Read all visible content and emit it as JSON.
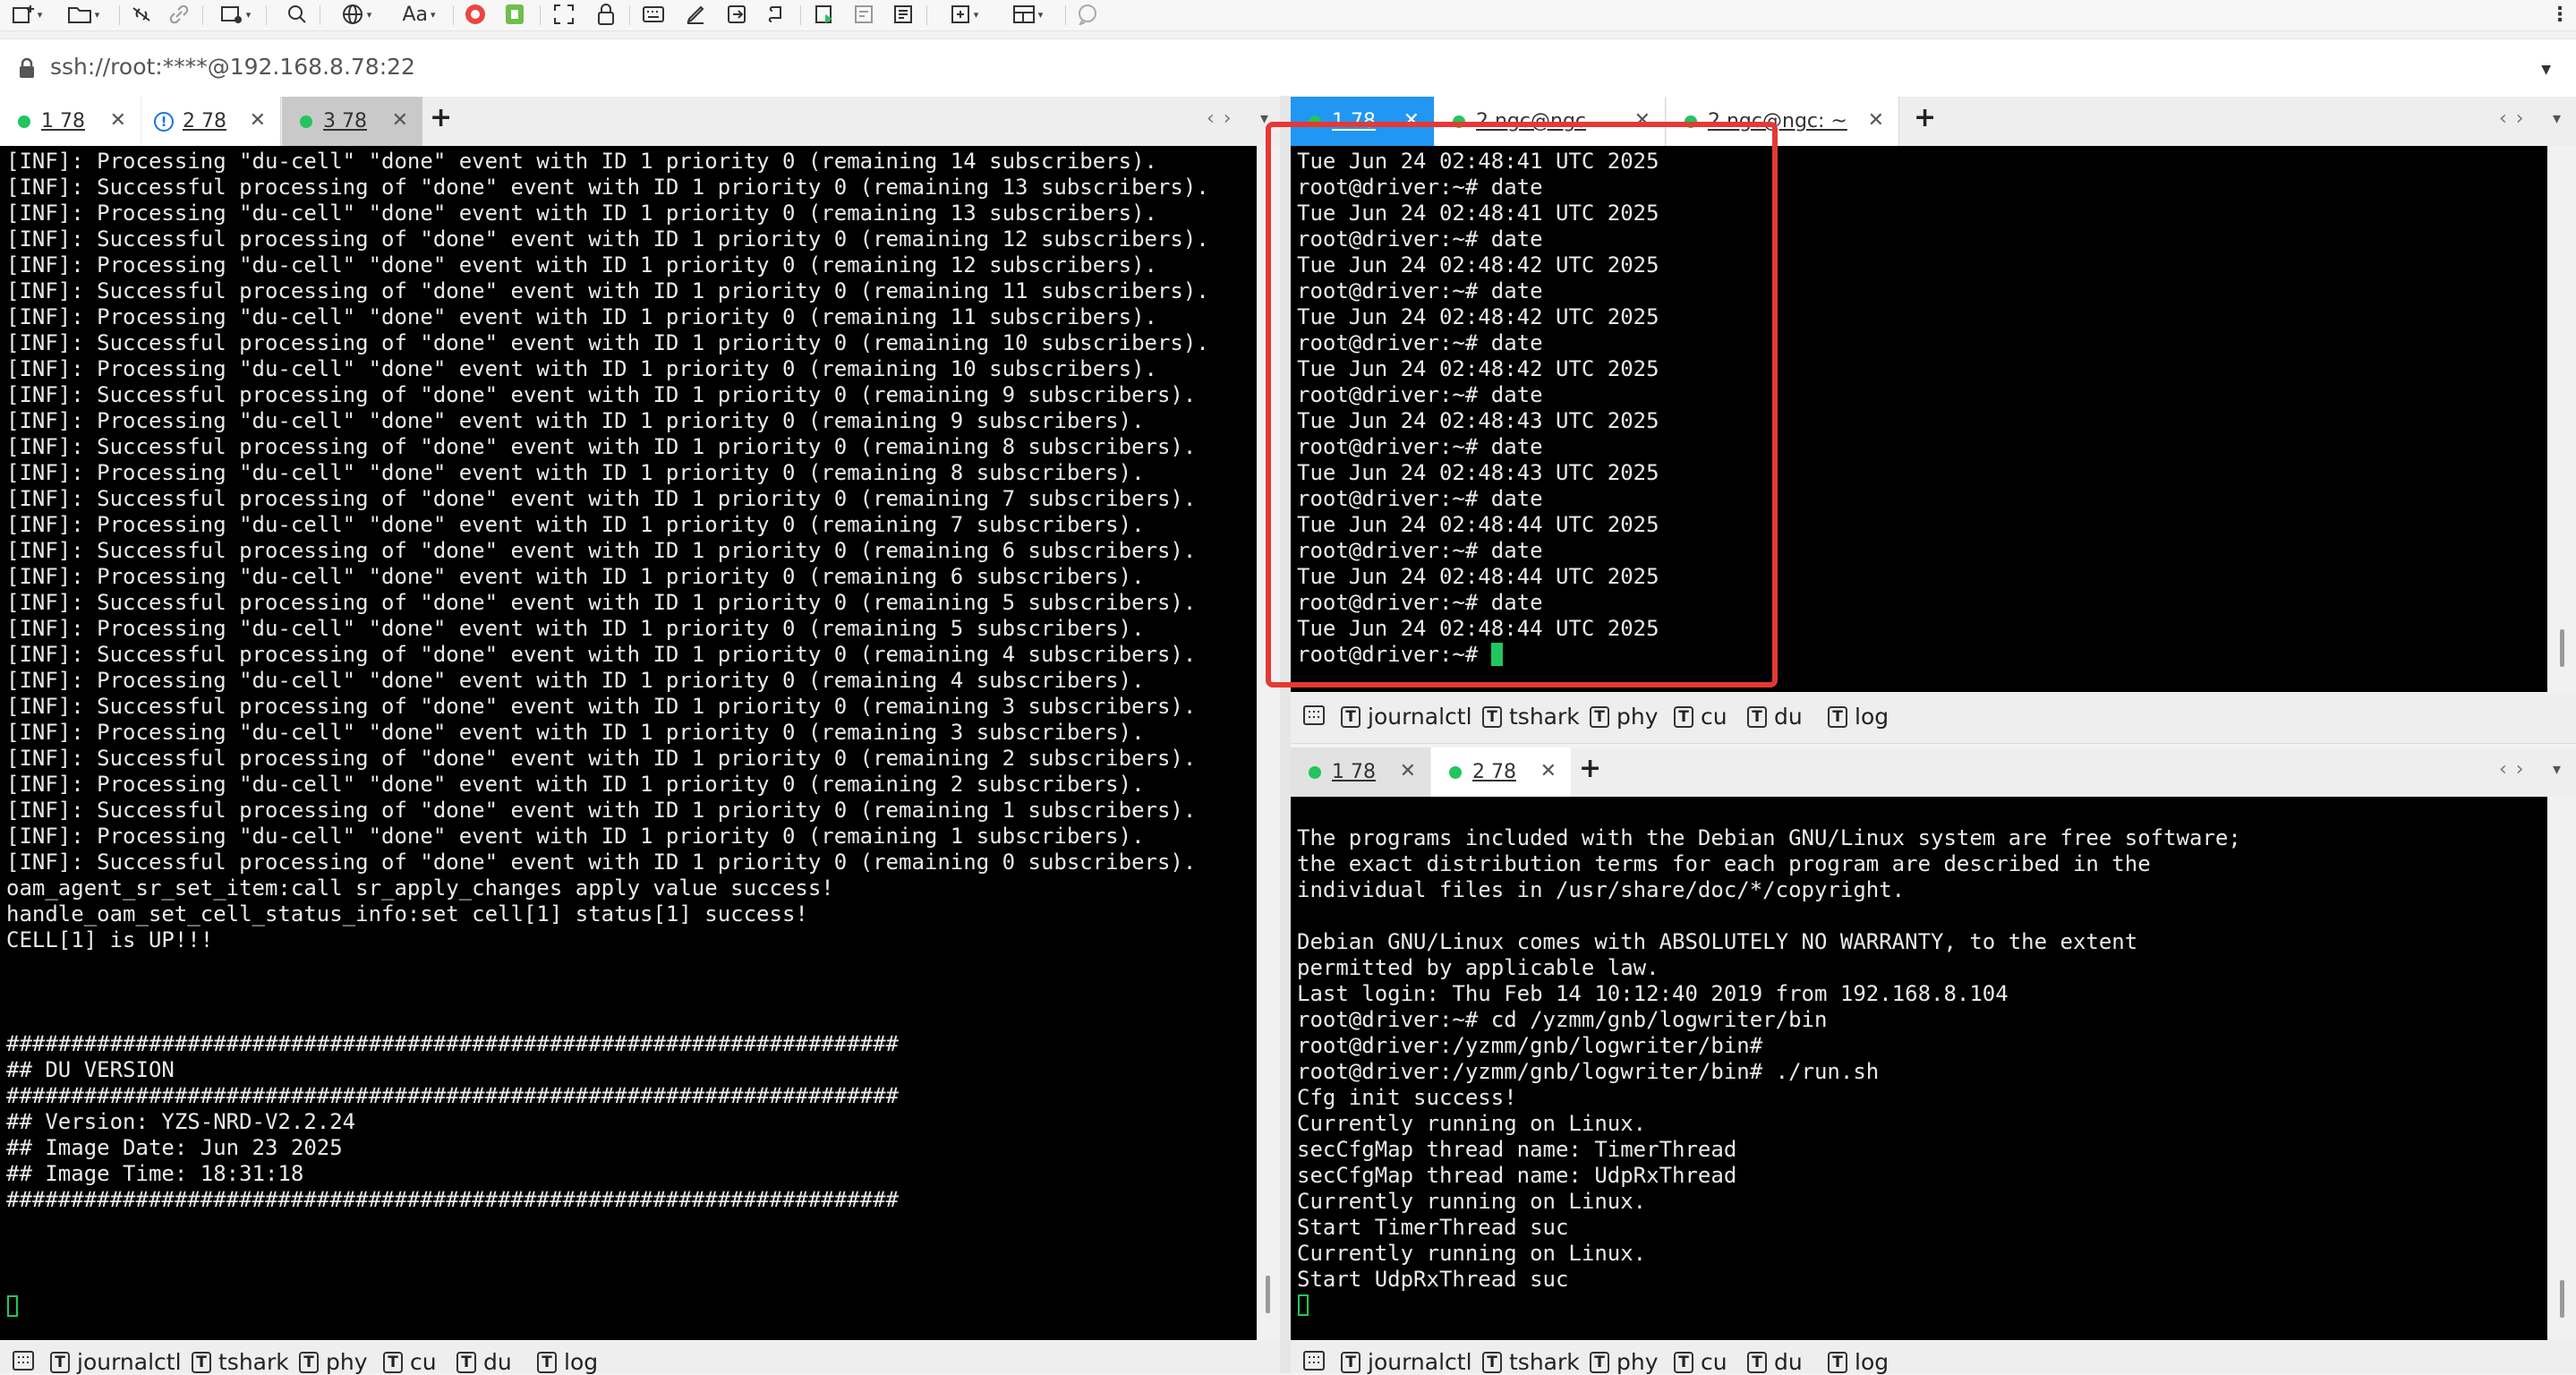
{
  "toolbar": {
    "icons": [
      "new-session-icon",
      "open-folder-icon",
      "unlink-icon",
      "link-icon",
      "new-window-icon",
      "search-icon",
      "globe-icon",
      "font-icon",
      "record-icon",
      "file-transfer-icon",
      "fullscreen-icon",
      "lock-icon",
      "keyboard-icon",
      "sign-icon",
      "import-icon",
      "script-icon",
      "play-script-icon",
      "compose-icon",
      "notes-icon",
      "add-pane-icon",
      "layout-icon",
      "chat-icon",
      "more-icon"
    ],
    "font_label": "Aa"
  },
  "address": {
    "url": "ssh://root:****@192.168.8.78:22"
  },
  "left_tabs": [
    {
      "label": "1 78",
      "status": "connected"
    },
    {
      "label": "2 78",
      "status": "warning"
    },
    {
      "label": "3 78",
      "status": "connected"
    }
  ],
  "right_top_tabs": [
    {
      "label": "1 78",
      "status": "connected"
    },
    {
      "label": "2 ngc@ngc",
      "status": "connected"
    },
    {
      "label": "2 ngc@ngc: ~",
      "status": "connected"
    }
  ],
  "right_bottom_tabs": [
    {
      "label": "1 78",
      "status": "connected"
    },
    {
      "label": "2 78",
      "status": "connected"
    }
  ],
  "terminals": {
    "left": "[INF]: Processing \"du-cell\" \"done\" event with ID 1 priority 0 (remaining 14 subscribers).\n[INF]: Successful processing of \"done\" event with ID 1 priority 0 (remaining 13 subscribers).\n[INF]: Processing \"du-cell\" \"done\" event with ID 1 priority 0 (remaining 13 subscribers).\n[INF]: Successful processing of \"done\" event with ID 1 priority 0 (remaining 12 subscribers).\n[INF]: Processing \"du-cell\" \"done\" event with ID 1 priority 0 (remaining 12 subscribers).\n[INF]: Successful processing of \"done\" event with ID 1 priority 0 (remaining 11 subscribers).\n[INF]: Processing \"du-cell\" \"done\" event with ID 1 priority 0 (remaining 11 subscribers).\n[INF]: Successful processing of \"done\" event with ID 1 priority 0 (remaining 10 subscribers).\n[INF]: Processing \"du-cell\" \"done\" event with ID 1 priority 0 (remaining 10 subscribers).\n[INF]: Successful processing of \"done\" event with ID 1 priority 0 (remaining 9 subscribers).\n[INF]: Processing \"du-cell\" \"done\" event with ID 1 priority 0 (remaining 9 subscribers).\n[INF]: Successful processing of \"done\" event with ID 1 priority 0 (remaining 8 subscribers).\n[INF]: Processing \"du-cell\" \"done\" event with ID 1 priority 0 (remaining 8 subscribers).\n[INF]: Successful processing of \"done\" event with ID 1 priority 0 (remaining 7 subscribers).\n[INF]: Processing \"du-cell\" \"done\" event with ID 1 priority 0 (remaining 7 subscribers).\n[INF]: Successful processing of \"done\" event with ID 1 priority 0 (remaining 6 subscribers).\n[INF]: Processing \"du-cell\" \"done\" event with ID 1 priority 0 (remaining 6 subscribers).\n[INF]: Successful processing of \"done\" event with ID 1 priority 0 (remaining 5 subscribers).\n[INF]: Processing \"du-cell\" \"done\" event with ID 1 priority 0 (remaining 5 subscribers).\n[INF]: Successful processing of \"done\" event with ID 1 priority 0 (remaining 4 subscribers).\n[INF]: Processing \"du-cell\" \"done\" event with ID 1 priority 0 (remaining 4 subscribers).\n[INF]: Successful processing of \"done\" event with ID 1 priority 0 (remaining 3 subscribers).\n[INF]: Processing \"du-cell\" \"done\" event with ID 1 priority 0 (remaining 3 subscribers).\n[INF]: Successful processing of \"done\" event with ID 1 priority 0 (remaining 2 subscribers).\n[INF]: Processing \"du-cell\" \"done\" event with ID 1 priority 0 (remaining 2 subscribers).\n[INF]: Successful processing of \"done\" event with ID 1 priority 0 (remaining 1 subscribers).\n[INF]: Processing \"du-cell\" \"done\" event with ID 1 priority 0 (remaining 1 subscribers).\n[INF]: Successful processing of \"done\" event with ID 1 priority 0 (remaining 0 subscribers).\noam_agent_sr_set_item:call sr_apply_changes apply value success!\nhandle_oam_set_cell_status_info:set cell[1] status[1] success!\nCELL[1] is UP!!!\n\n\n\n#####################################################################\n## DU VERSION\n#####################################################################\n## Version: YZS-NRD-V2.2.24\n## Image Date: Jun 23 2025\n## Image Time: 18:31:18\n#####################################################################",
    "right_top": "Tue Jun 24 02:48:41 UTC 2025\nroot@driver:~# date\nTue Jun 24 02:48:41 UTC 2025\nroot@driver:~# date\nTue Jun 24 02:48:42 UTC 2025\nroot@driver:~# date\nTue Jun 24 02:48:42 UTC 2025\nroot@driver:~# date\nTue Jun 24 02:48:42 UTC 2025\nroot@driver:~# date\nTue Jun 24 02:48:43 UTC 2025\nroot@driver:~# date\nTue Jun 24 02:48:43 UTC 2025\nroot@driver:~# date\nTue Jun 24 02:48:44 UTC 2025\nroot@driver:~# date\nTue Jun 24 02:48:44 UTC 2025\nroot@driver:~# date\nTue Jun 24 02:48:44 UTC 2025",
    "right_top_prompt": "root@driver:~# ",
    "right_bottom": "\nThe programs included with the Debian GNU/Linux system are free software;\nthe exact distribution terms for each program are described in the\nindividual files in /usr/share/doc/*/copyright.\n\nDebian GNU/Linux comes with ABSOLUTELY NO WARRANTY, to the extent\npermitted by applicable law.\nLast login: Thu Feb 14 10:12:40 2019 from 192.168.8.104\nroot@driver:~# cd /yzmm/gnb/logwriter/bin\nroot@driver:/yzmm/gnb/logwriter/bin#\nroot@driver:/yzmm/gnb/logwriter/bin# ./run.sh\nCfg init success!\nCurrently running on Linux.\nsecCfgMap thread name: TimerThread\nsecCfgMap thread name: UdpRxThread\nCurrently running on Linux.\nStart TimerThread suc\nCurrently running on Linux.\nStart UdpRxThread suc"
  },
  "quick_commands": [
    "journalctl",
    "tshark",
    "phy",
    "cu",
    "du",
    "log"
  ],
  "colors": {
    "accent": "#2196f3",
    "connected": "#22c55e",
    "highlight": "#e53935",
    "terminal_bg": "#000000"
  }
}
